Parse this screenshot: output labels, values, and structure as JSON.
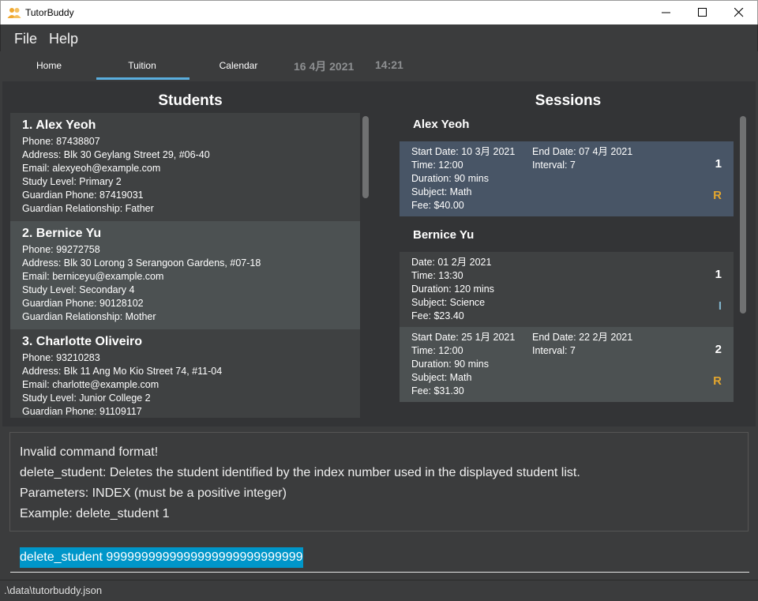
{
  "window": {
    "title": "TutorBuddy",
    "icon": "people-icon"
  },
  "menu": [
    "File",
    "Help"
  ],
  "tabs": [
    {
      "label": "Home",
      "active": false
    },
    {
      "label": "Tuition",
      "active": true
    },
    {
      "label": "Calendar",
      "active": false
    }
  ],
  "clock": {
    "date": "16 4月 2021",
    "time": "14:21"
  },
  "students_panel": {
    "title": "Students",
    "items": [
      {
        "name": "1.  Alex Yeoh",
        "lines": [
          "Phone: 87438807",
          "Address: Blk 30 Geylang Street 29, #06-40",
          "Email: alexyeoh@example.com",
          "Study Level: Primary 2",
          "Guardian Phone: 87419031",
          "Guardian Relationship: Father"
        ]
      },
      {
        "name": "2.  Bernice Yu",
        "lines": [
          "Phone: 99272758",
          "Address: Blk 30 Lorong 3 Serangoon Gardens, #07-18",
          "Email: berniceyu@example.com",
          "Study Level: Secondary 4",
          "Guardian Phone: 90128102",
          "Guardian Relationship: Mother"
        ]
      },
      {
        "name": "3.  Charlotte Oliveiro",
        "lines": [
          "Phone: 93210283",
          "Address: Blk 11 Ang Mo Kio Street 74, #11-04",
          "Email: charlotte@example.com",
          "Study Level: Junior College 2",
          "Guardian Phone: 91109117"
        ]
      }
    ]
  },
  "sessions_panel": {
    "title": "Sessions",
    "groups": [
      {
        "student": "Alex Yeoh",
        "sessions": [
          {
            "left": [
              "Start Date: 10 3月 2021",
              "Time: 12:00",
              "Duration: 90 mins",
              "Subject: Math",
              "Fee: $40.00"
            ],
            "right": [
              "End Date: 07 4月 2021",
              "Interval: 7"
            ],
            "index": "1",
            "type": "R",
            "type_color": "#e3a62e",
            "bg": "blue"
          }
        ]
      },
      {
        "student": "Bernice Yu",
        "sessions": [
          {
            "left": [
              "Date: 01 2月 2021",
              "Time: 13:30",
              "Duration: 120 mins",
              "Subject: Science",
              "Fee: $23.40"
            ],
            "right": [],
            "index": "1",
            "type": "I",
            "type_color": "#7fb2c9",
            "bg": "gray"
          },
          {
            "left": [
              "Start Date: 25 1月 2021",
              "Time: 12:00",
              "Duration: 90 mins",
              "Subject: Math",
              "Fee: $31.30"
            ],
            "right": [
              "End Date: 22 2月 2021",
              "Interval: 7"
            ],
            "index": "2",
            "type": "R",
            "type_color": "#e3a62e",
            "bg": "gray2"
          }
        ]
      }
    ]
  },
  "result": {
    "lines": [
      "Invalid command format!",
      "delete_student: Deletes the student identified by the index number used in the displayed student list.",
      "Parameters: INDEX (must be a positive integer)",
      "Example: delete_student 1"
    ]
  },
  "command": {
    "value": "delete_student 9999999999999999999999999999"
  },
  "status": {
    "file_path": ".\\data\\tutorbuddy.json"
  }
}
